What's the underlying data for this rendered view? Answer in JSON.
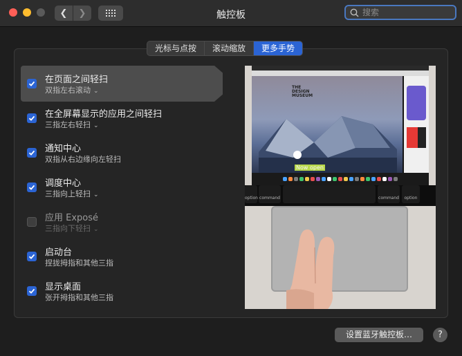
{
  "window": {
    "title": "触控板"
  },
  "search": {
    "placeholder": "搜索",
    "value": ""
  },
  "tabs": [
    {
      "label": "光标与点按",
      "active": false
    },
    {
      "label": "滚动缩放",
      "active": false
    },
    {
      "label": "更多手势",
      "active": true
    }
  ],
  "gestures": [
    {
      "title": "在页面之间轻扫",
      "subtitle": "双指左右滚动",
      "checked": true,
      "enabled": true,
      "has_menu": true,
      "selected": true
    },
    {
      "title": "在全屏幕显示的应用之间轻扫",
      "subtitle": "三指左右轻扫",
      "checked": true,
      "enabled": true,
      "has_menu": true,
      "selected": false
    },
    {
      "title": "通知中心",
      "subtitle": "双指从右边缘向左轻扫",
      "checked": true,
      "enabled": true,
      "has_menu": false,
      "selected": false
    },
    {
      "title": "调度中心",
      "subtitle": "三指向上轻扫",
      "checked": true,
      "enabled": true,
      "has_menu": true,
      "selected": false
    },
    {
      "title": "应用 Exposé",
      "subtitle": "三指向下轻扫",
      "checked": false,
      "enabled": false,
      "has_menu": true,
      "selected": false
    },
    {
      "title": "启动台",
      "subtitle": "捏拢拇指和其他三指",
      "checked": true,
      "enabled": true,
      "has_menu": false,
      "selected": false
    },
    {
      "title": "显示桌面",
      "subtitle": "张开拇指和其他三指",
      "checked": true,
      "enabled": true,
      "has_menu": false,
      "selected": false
    }
  ],
  "preview": {
    "site_logo": "THE\nDESIGN\nMUSEUM",
    "site_highlight": "Now open",
    "keys": [
      "option",
      "command",
      "command",
      "option"
    ],
    "key_symbols": [
      "alt",
      "⌘",
      "⌘",
      "alt"
    ]
  },
  "footer": {
    "bluetooth_button": "设置蓝牙触控板…",
    "help_button": "?"
  },
  "colors": {
    "accent": "#2b64d4",
    "traffic_red": "#ff5f57",
    "traffic_yellow": "#febc2e"
  }
}
